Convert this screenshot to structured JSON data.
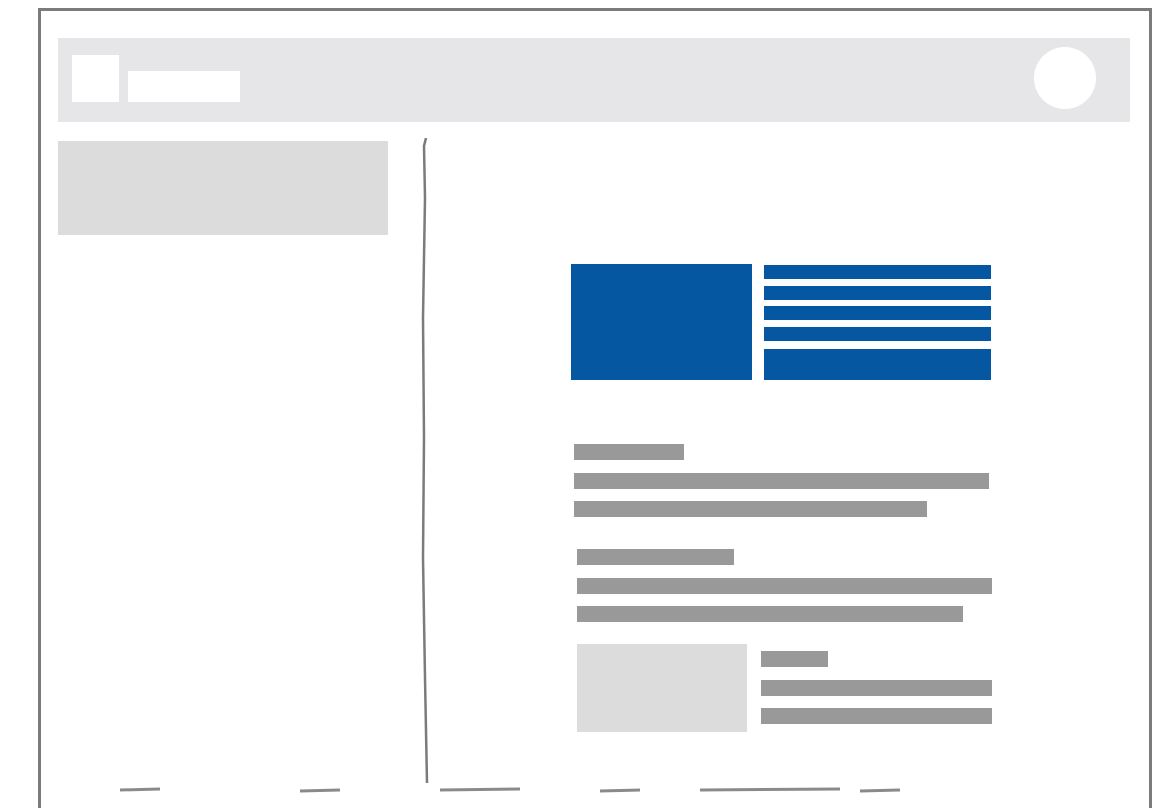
{
  "wireframe": {
    "accent_color": "#0657a2",
    "placeholder_color": "#999999",
    "panel_color": "#dcdcdc",
    "header_color": "#e6e6e8",
    "frame_color": "#7b7b7b"
  },
  "header": {
    "logo_icon": "logo-placeholder",
    "avatar_icon": "user-avatar-placeholder"
  },
  "main": {
    "hero": {
      "image_icon": "image-placeholder",
      "text_lines": 4,
      "has_button": true
    },
    "sections": [
      {
        "heading_lines": 1,
        "body_lines": 2
      },
      {
        "heading_lines": 1,
        "body_lines": 2
      }
    ],
    "media_item": {
      "thumbnail_icon": "image-placeholder",
      "heading_lines": 1,
      "body_lines": 2
    }
  }
}
